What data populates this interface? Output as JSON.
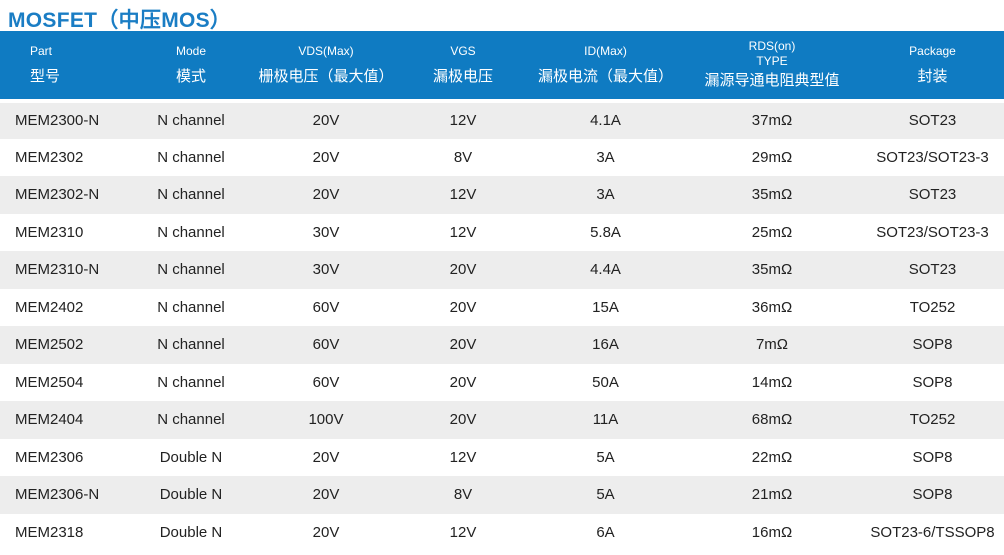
{
  "title": "MOSFET（中压MOS）",
  "headers": [
    {
      "en": "Part",
      "zh": "型号"
    },
    {
      "en": "Mode",
      "zh": "模式"
    },
    {
      "en": "VDS(Max)",
      "zh": "栅极电压（最大值）"
    },
    {
      "en": "VGS",
      "zh": "漏极电压"
    },
    {
      "en": "ID(Max)",
      "zh": "漏极电流（最大值）"
    },
    {
      "en": "RDS(on)",
      "en2": "TYPE",
      "zh": "漏源导通电阻典型值"
    },
    {
      "en": "Package",
      "zh": "封装"
    }
  ],
  "rows": [
    [
      "MEM2300-N",
      "N channel",
      "20V",
      "12V",
      "4.1A",
      "37mΩ",
      "SOT23"
    ],
    [
      "MEM2302",
      "N channel",
      "20V",
      "8V",
      "3A",
      "29mΩ",
      "SOT23/SOT23-3"
    ],
    [
      "MEM2302-N",
      "N channel",
      "20V",
      "12V",
      "3A",
      "35mΩ",
      "SOT23"
    ],
    [
      "MEM2310",
      "N channel",
      "30V",
      "12V",
      "5.8A",
      "25mΩ",
      "SOT23/SOT23-3"
    ],
    [
      "MEM2310-N",
      "N channel",
      "30V",
      "20V",
      "4.4A",
      "35mΩ",
      "SOT23"
    ],
    [
      "MEM2402",
      "N channel",
      "60V",
      "20V",
      "15A",
      "36mΩ",
      "TO252"
    ],
    [
      "MEM2502",
      "N channel",
      "60V",
      "20V",
      "16A",
      "7mΩ",
      "SOP8"
    ],
    [
      "MEM2504",
      "N channel",
      "60V",
      "20V",
      "50A",
      "14mΩ",
      "SOP8"
    ],
    [
      "MEM2404",
      "N channel",
      "100V",
      "20V",
      "11A",
      "68mΩ",
      "TO252"
    ],
    [
      "MEM2306",
      "Double N",
      "20V",
      "12V",
      "5A",
      "22mΩ",
      "SOP8"
    ],
    [
      "MEM2306-N",
      "Double N",
      "20V",
      "8V",
      "5A",
      "21mΩ",
      "SOP8"
    ],
    [
      "MEM2318",
      "Double N",
      "20V",
      "12V",
      "6A",
      "16mΩ",
      "SOT23-6/TSSOP8"
    ]
  ]
}
